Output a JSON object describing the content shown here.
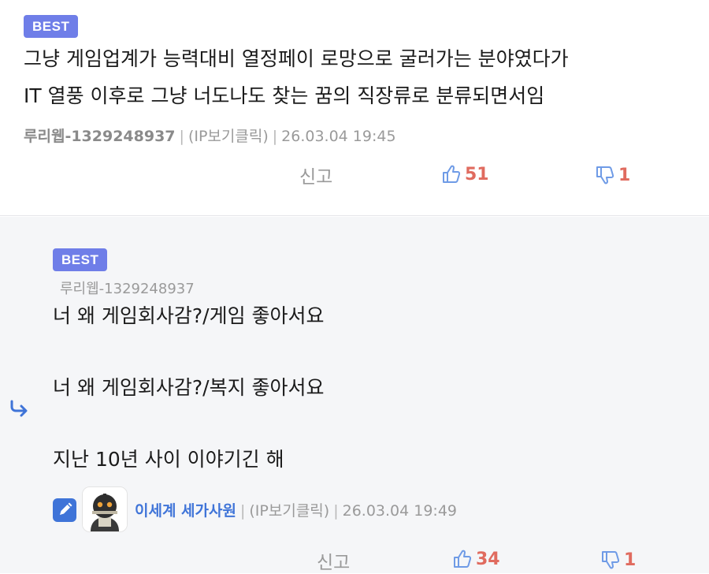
{
  "top_comment": {
    "badge": "BEST",
    "lines": [
      "그냥 게임업계가 능력대비 열정페이 로망으로 굴러가는 분야였다가",
      "IT 열풍 이후로 그냥 너도나도 찾는 꿈의 직장류로 분류되면서임"
    ],
    "author": "루리웹-1329248937",
    "ip_label": "(IP보기클릭)",
    "timestamp": "26.03.04 19:45",
    "report_label": "신고",
    "likes": "51",
    "dislikes": "1"
  },
  "reply": {
    "badge": "BEST",
    "reply_to": "루리웹-1329248937",
    "lines": [
      "너 왜 게임회사감?/게임 좋아서요",
      "너 왜 게임회사감?/복지 좋아서요",
      "지난 10년 사이 이야기긴 해"
    ],
    "author": "이세계 세가사원",
    "ip_label": "(IP보기클릭)",
    "timestamp": "26.03.04 19:49",
    "report_label": "신고",
    "likes": "34",
    "dislikes": "1",
    "icons": {
      "reply_arrow": "reply-arrow-icon",
      "edit": "pencil-icon",
      "avatar": "robot-avatar"
    }
  },
  "colors": {
    "badge": "#6f7ee8",
    "like_icon": "#6f9be6",
    "count": "#e06b5f",
    "reply_bg": "#f5f6f8",
    "edit_icon_bg": "#3f74d8"
  }
}
